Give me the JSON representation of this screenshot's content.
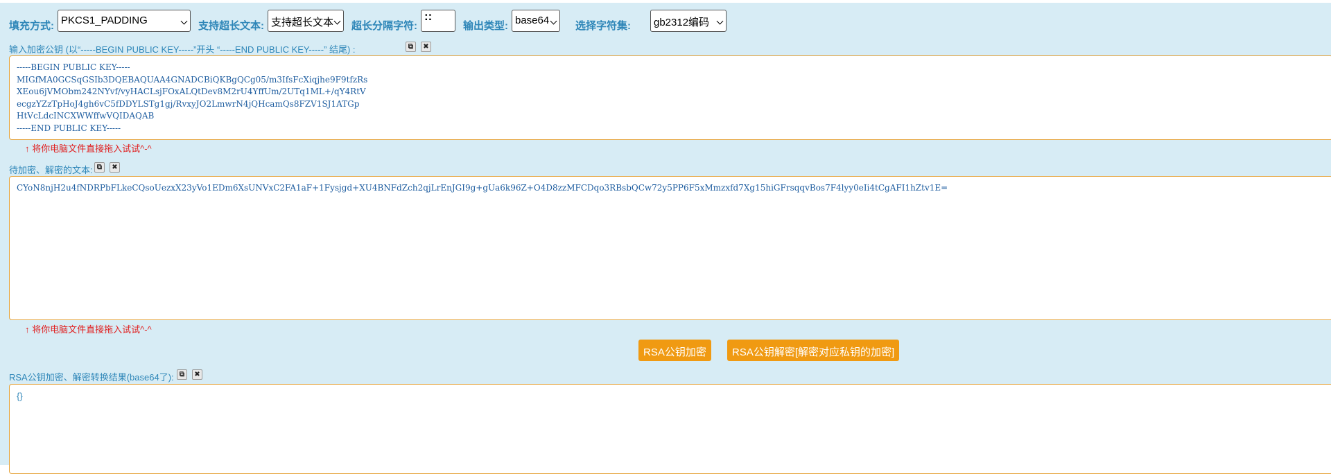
{
  "toolbar": {
    "padding_label": "填充方式:",
    "padding_value": "PKCS1_PADDING",
    "longtext_label": "支持超长文本:",
    "longtext_value": "支持超长文本",
    "separator_label": "超长分隔字符:",
    "separator_value": "::",
    "output_label": "输出类型:",
    "output_value": "base64",
    "charset_label": "选择字符集:",
    "charset_value": "gb2312编码"
  },
  "pubkey": {
    "label": "输入加密公钥 (以“-----BEGIN PUBLIC KEY-----”开头 “-----END PUBLIC KEY-----” 结尾) :",
    "value": "-----BEGIN PUBLIC KEY-----\nMIGfMA0GCSqGSIb3DQEBAQUAA4GNADCBiQKBgQCg05/m3IfsFcXiqjhe9F9tfzRs\nXEou6jVMObm242NYvf/vyHACLsjFOxALQtDev8M2rU4YffUm/2UTq1ML+/qY4RtV\necgzYZzTpHoJ4gh6vC5fDDYLSTg1gj/RvxyJO2LmwrN4jQHcamQs8FZV1SJ1ATGp\nHtVcLdcINCXWWffwVQIDAQAB\n-----END PUBLIC KEY-----",
    "hint": "将你电脑文件直接拖入试试^-^"
  },
  "plaintext": {
    "label": "待加密、解密的文本:",
    "value": "CYoN8njH2u4fNDRPbFLkeCQsoUezxX23yVo1EDm6XsUNVxC2FA1aF+1Fysjgd+XU4BNFdZch2qjLrEnJGI9g+gUa6k96Z+O4D8zzMFCDqo3RBsbQCw72y5PP6F5xMmzxfd7Xg15hiGFrsqqvBos7F4lyy0eIi4tCgAFI1hZtv1E=",
    "hint": "将你电脑文件直接拖入试试^-^"
  },
  "actions": {
    "encrypt_label": "RSA公钥加密",
    "decrypt_label": "RSA公钥解密[解密对应私钥的加密]"
  },
  "result": {
    "label": "RSA公钥加密、解密转换结果(base64了):",
    "value": "{}"
  },
  "icons": {
    "copy": "copy-icon",
    "clear": "close-icon"
  }
}
